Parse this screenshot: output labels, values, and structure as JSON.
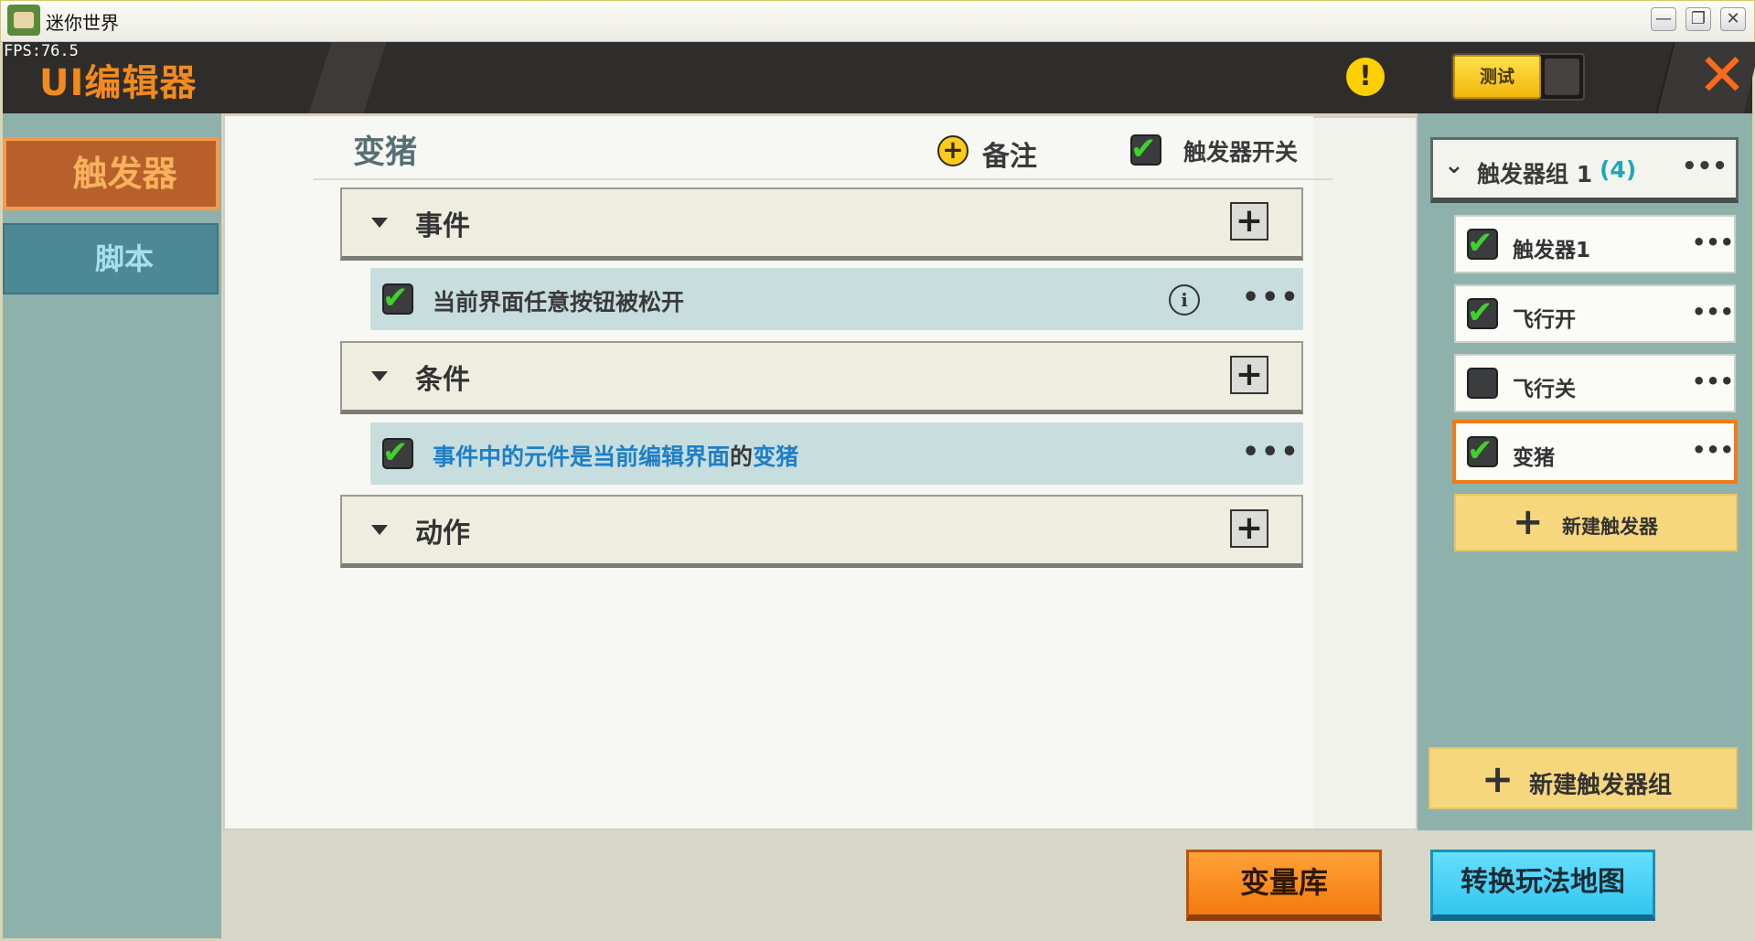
{
  "window": {
    "title": "迷你世界"
  },
  "header": {
    "fps": "FPS:76.5",
    "title": "UI编辑器",
    "warning_symbol": "!",
    "test_label": "测试",
    "close_symbol": "✕"
  },
  "left_tabs": [
    {
      "label": "触发器",
      "active": true
    },
    {
      "label": "脚本",
      "active": false
    }
  ],
  "main": {
    "trigger_name": "变猪",
    "note_label": "备注",
    "switch_label": "触发器开关",
    "switch_checked": true,
    "sections": [
      {
        "label": "事件"
      },
      {
        "label": "条件"
      },
      {
        "label": "动作"
      }
    ],
    "event_item": {
      "text": "当前界面任意按钮被松开",
      "checked": true
    },
    "condition_item": {
      "part1": "事件中的元件",
      "part2": "是",
      "part3": "当前编辑界面",
      "part4": "的",
      "part5": "变猪",
      "checked": true
    }
  },
  "right": {
    "group": {
      "name": "触发器组 1",
      "count": "(4)"
    },
    "triggers": [
      {
        "name": "触发器1",
        "checked": true,
        "selected": false
      },
      {
        "name": "飞行开",
        "checked": true,
        "selected": false
      },
      {
        "name": "飞行关",
        "checked": false,
        "selected": false
      },
      {
        "name": "变猪",
        "checked": true,
        "selected": true
      }
    ],
    "new_trigger_label": "新建触发器",
    "new_group_label": "新建触发器组"
  },
  "bottom": {
    "variable_library": "变量库",
    "convert_map": "转换玩法地图"
  },
  "colors": {
    "accent_orange": "#f28a1e",
    "check_green": "#3ed12c",
    "link_blue": "#1e7fc8",
    "cyan_button": "#33c5ef"
  }
}
